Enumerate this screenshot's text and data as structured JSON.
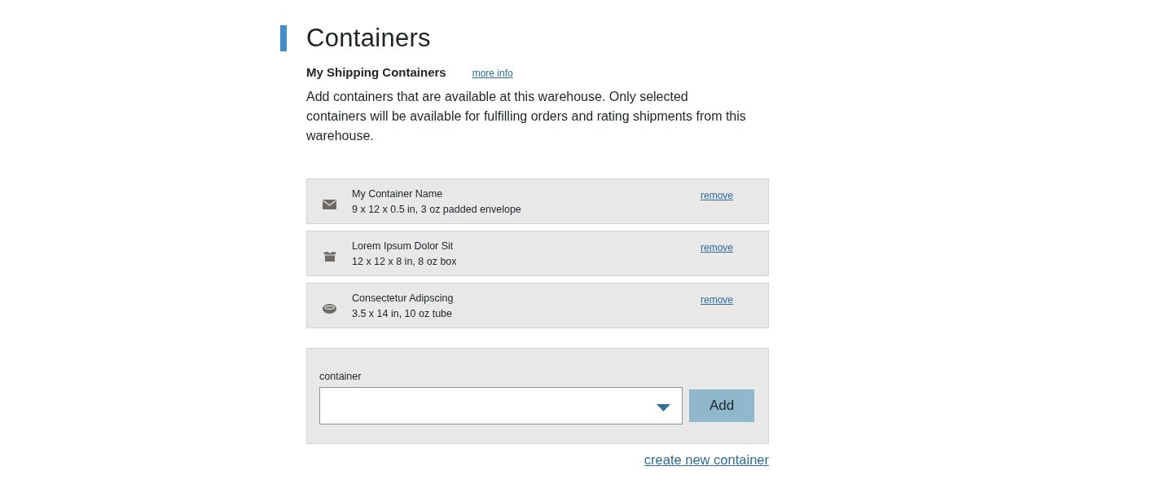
{
  "heading": "Containers",
  "section": {
    "title": "My Shipping Containers",
    "link": "more info"
  },
  "description": "Add containers that are available at this warehouse. Only selected containers will be available for fulfilling orders and rating shipments from this warehouse.",
  "containers": [
    {
      "kind": "envelope",
      "name": "My Container Name",
      "details": "9 x 12 x 0.5 in, 3 oz padded envelope",
      "action": "remove"
    },
    {
      "kind": "box",
      "name": "Lorem Ipsum Dolor Sit",
      "details": "12 x 12 x 8 in, 8 oz box",
      "action": "remove"
    },
    {
      "kind": "tube",
      "name": "Consectetur Adipscing",
      "details": "3.5 x 14 in, 10 oz tube",
      "action": "remove"
    }
  ],
  "add_form": {
    "label": "container",
    "button": "Add"
  },
  "create_link": "create new container"
}
